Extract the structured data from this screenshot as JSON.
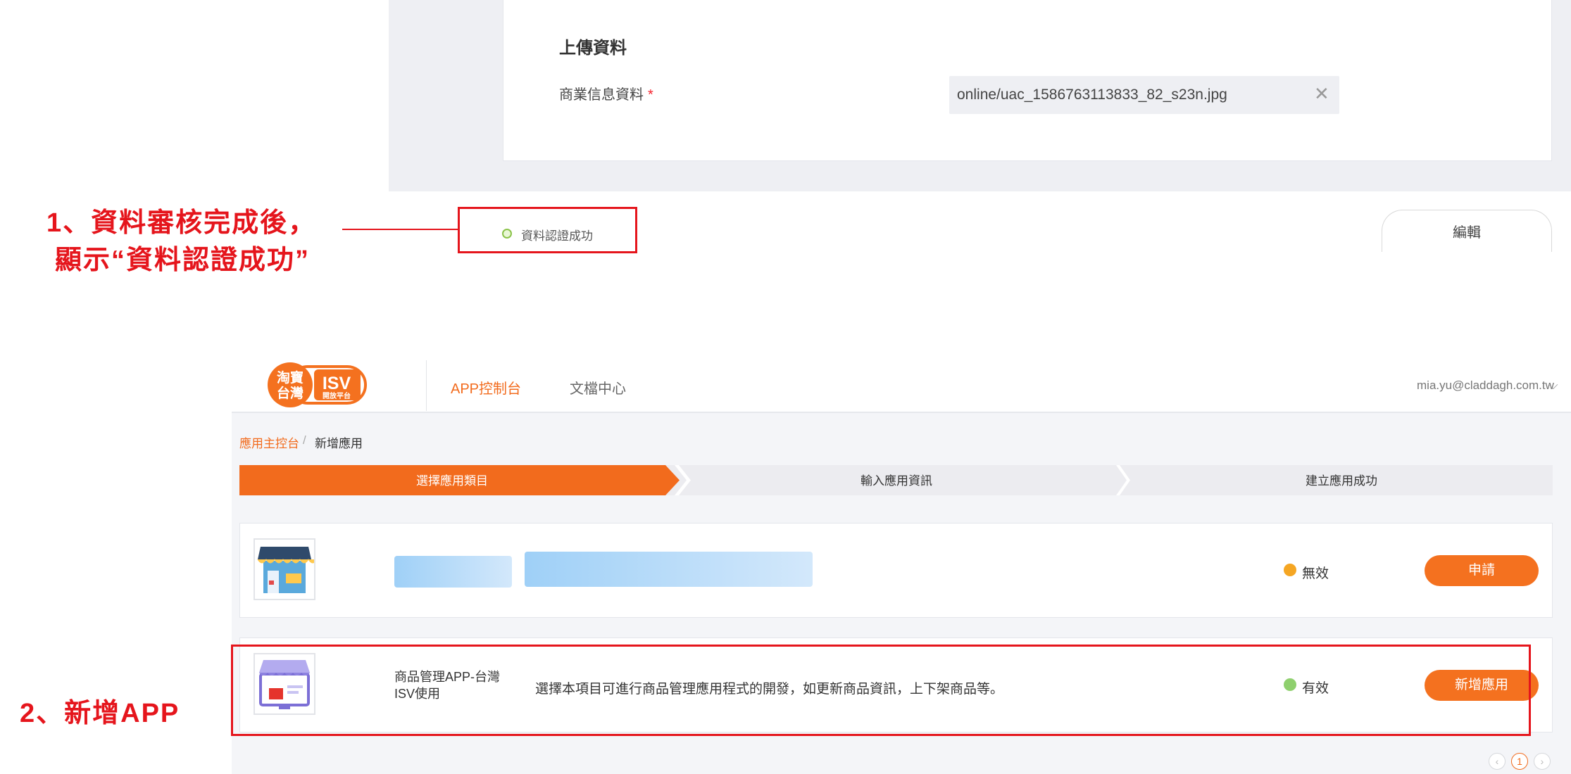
{
  "upload_section": {
    "title": "上傳資料",
    "business_info_label": "商業信息資料",
    "required_mark": "*",
    "file_value": "online/uac_1586763113833_82_s23n.jpg",
    "clear_glyph": "✕"
  },
  "verification": {
    "status_text": "資料認證成功",
    "edit_label": "編輯"
  },
  "annotations": {
    "note1_line1": "1、資料審核完成後，",
    "note1_line2": "顯示“資料認證成功”",
    "note2": "2、新增APP"
  },
  "navbar": {
    "logo_left": "淘寶台灣",
    "logo_isv": "ISV",
    "logo_sub": "開放平台",
    "items": [
      {
        "label": "APP控制台",
        "active": true
      },
      {
        "label": "文檔中心",
        "active": false
      }
    ],
    "user_email": "mia.yu@claddagh.com.tw",
    "user_caret": "⌵"
  },
  "breadcrumb": {
    "home": "應用主控台",
    "separator": "/",
    "current": "新增應用"
  },
  "steps": [
    {
      "label": "選擇應用類目",
      "active": true
    },
    {
      "label": "輸入應用資訊",
      "active": false
    },
    {
      "label": "建立應用成功",
      "active": false
    }
  ],
  "app_list": [
    {
      "icon": "storefront-icon",
      "name": "",
      "description": "",
      "status": "無效",
      "status_color": "#f5a623",
      "action_label": "申請"
    },
    {
      "icon": "product-management-icon",
      "name": "商品管理APP-台灣ISV使用",
      "description": "選擇本項目可進行商品管理應用程式的開發，如更新商品資訊，上下架商品等。",
      "status": "有效",
      "status_color": "#8fd06e",
      "action_label": "新增應用"
    }
  ],
  "pagination": {
    "prev": "‹",
    "current": "1",
    "next": "›"
  },
  "colors": {
    "accent": "#f26b1d",
    "annotation_red": "#e5151c"
  }
}
